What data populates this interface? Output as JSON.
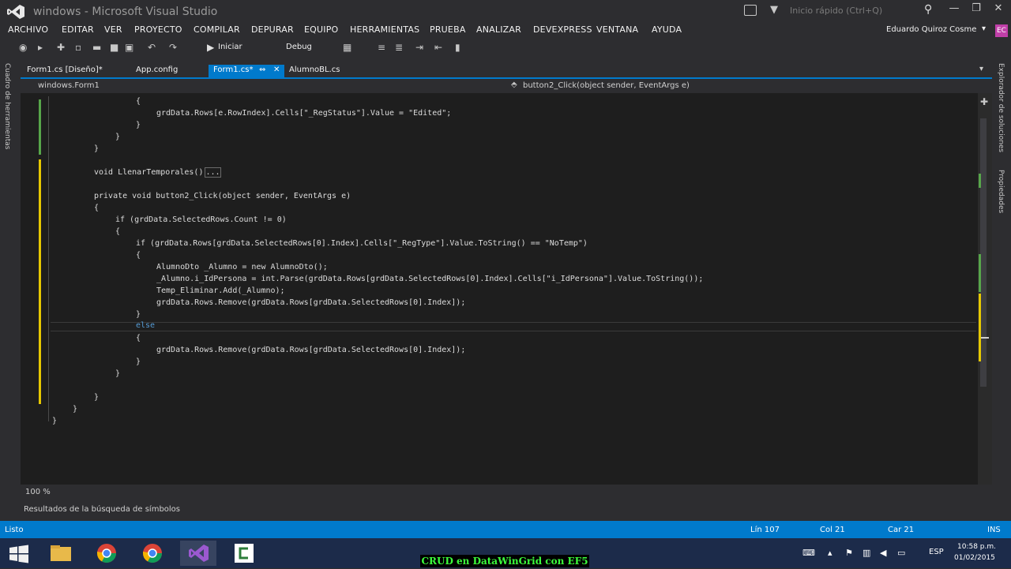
{
  "window": {
    "title": "windows - Microsoft Visual Studio",
    "quick_launch_placeholder": "Inicio rápido (Ctrl+Q)",
    "minimize": "—",
    "restore": "❐",
    "close": "✕"
  },
  "menu": [
    "ARCHIVO",
    "EDITAR",
    "VER",
    "PROYECTO",
    "COMPILAR",
    "DEPURAR",
    "EQUIPO",
    "HERRAMIENTAS",
    "PRUEBA",
    "ANALIZAR",
    "DEVEXPRESS",
    "VENTANA",
    "AYUDA"
  ],
  "user": {
    "name": "Eduardo Quiroz Cosme",
    "initials": "EC",
    "avatar_color": "#c03fa8"
  },
  "toolbar": {
    "start_label": "Iniciar",
    "config_label": "Debug"
  },
  "side_panels": {
    "toolbox": "Cuadro de herramientas",
    "solution_explorer": "Explorador de soluciones",
    "properties": "Propiedades"
  },
  "tabs": [
    {
      "label": "Form1.cs [Diseño]*",
      "active": false
    },
    {
      "label": "App.config",
      "active": false
    },
    {
      "label": "Form1.cs*",
      "active": true
    },
    {
      "label": "AlumnoBL.cs",
      "active": false
    }
  ],
  "navbar": {
    "class": "windows.Form1",
    "member": "button2_Click(object sender, EventArgs e)"
  },
  "code": [
    {
      "text": "{"
    },
    {
      "text": "grdData.Rows[e.RowIndex].Cells[\"_RegStatus\"].Value = \"Edited\";"
    },
    {
      "text": "}"
    },
    {
      "text": "}"
    },
    {
      "text": "}"
    },
    {
      "text": "void LlenarTemporales()"
    },
    {
      "text": "private void button2_Click(object sender, EventArgs e)"
    },
    {
      "text": "{"
    },
    {
      "text": "if (grdData.SelectedRows.Count != 0)"
    },
    {
      "text": "{"
    },
    {
      "text": "if (grdData.Rows[grdData.SelectedRows[0].Index].Cells[\"_RegType\"].Value.ToString() == \"NoTemp\")"
    },
    {
      "text": "{"
    },
    {
      "text": "AlumnoDto _Alumno = new AlumnoDto();"
    },
    {
      "text": "_Alumno.i_IdPersona = int.Parse(grdData.Rows[grdData.SelectedRows[0].Index].Cells[\"i_IdPersona\"].Value.ToString());"
    },
    {
      "text": "Temp_Eliminar.Add(_Alumno);"
    },
    {
      "text": "grdData.Rows.Remove(grdData.Rows[grdData.SelectedRows[0].Index]);"
    },
    {
      "text": "}"
    },
    {
      "text": "else"
    },
    {
      "text": "{"
    },
    {
      "text": "grdData.Rows.Remove(grdData.Rows[grdData.SelectedRows[0].Index]);"
    },
    {
      "text": "}"
    },
    {
      "text": "}"
    },
    {
      "text": "}"
    },
    {
      "text": "}"
    },
    {
      "text": "}"
    }
  ],
  "zoom": "100 %",
  "output_tab": "Resultados de la búsqueda de símbolos",
  "status": {
    "ready": "Listo",
    "line": "Lín 107",
    "col": "Col 21",
    "char": "Car 21",
    "mode": "INS"
  },
  "taskbar": {
    "caption": "CRUD en DataWinGrid con EF5",
    "lang": "ESP",
    "time": "10:58 p.m.",
    "date": "01/02/2015"
  },
  "colors": {
    "accent": "#007acc",
    "editor_bg": "#1e1e1e",
    "keyword": "#569cd6",
    "type": "#4ec9b0",
    "string": "#d69d85"
  }
}
